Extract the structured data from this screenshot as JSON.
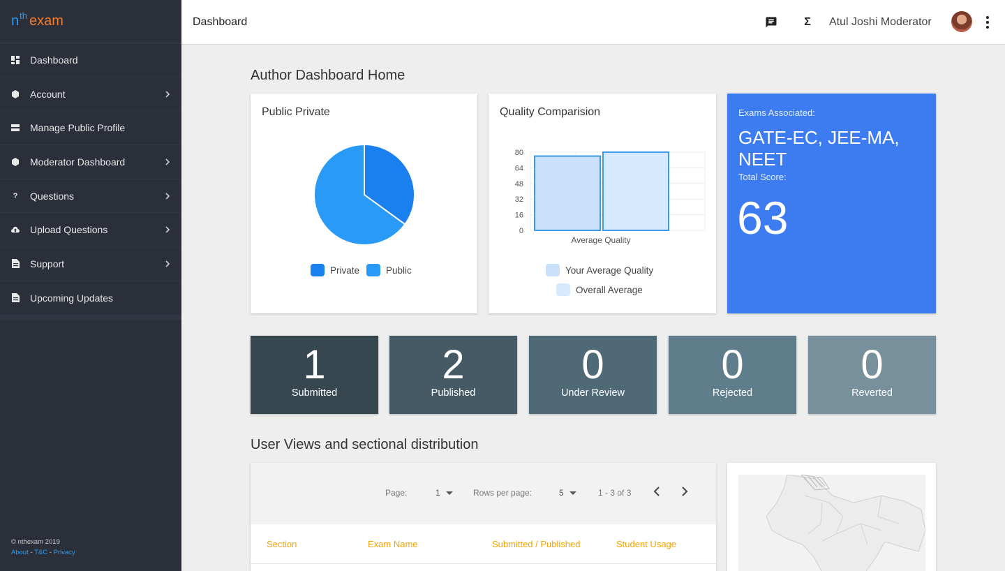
{
  "brand": {
    "n": "n",
    "th": "th",
    "exam": "exam"
  },
  "sidebar": {
    "items": [
      {
        "label": "Dashboard",
        "icon": "dashboard-icon",
        "chevron": false
      },
      {
        "label": "Account",
        "icon": "account-icon",
        "chevron": true
      },
      {
        "label": "Manage Public Profile",
        "icon": "profile-card-icon",
        "chevron": false
      },
      {
        "label": "Moderator Dashboard",
        "icon": "moderator-icon",
        "chevron": true
      },
      {
        "label": "Questions",
        "icon": "question-icon",
        "chevron": true
      },
      {
        "label": "Upload Questions",
        "icon": "cloud-upload-icon",
        "chevron": true
      },
      {
        "label": "Support",
        "icon": "document-icon",
        "chevron": true
      },
      {
        "label": "Upcoming Updates",
        "icon": "document-icon",
        "chevron": false
      }
    ],
    "footer": {
      "copyright": "© nthexam 2019",
      "about": "About",
      "tc": "T&C",
      "privacy": "Privacy",
      "sep": "-"
    }
  },
  "topbar": {
    "title": "Dashboard",
    "user": "Atul Joshi Moderator",
    "icons": [
      "feedback-icon",
      "sigma-icon",
      "avatar",
      "more-vert-icon"
    ]
  },
  "main": {
    "section1_title": "Author Dashboard Home",
    "section2_title": "User Views and sectional distribution"
  },
  "public_private": {
    "title": "Public Private",
    "legend": [
      "Private",
      "Public"
    ]
  },
  "quality": {
    "title": "Quality Comparision",
    "legend": [
      "Your Average Quality",
      "Overall Average"
    ]
  },
  "exams": {
    "assoc_label": "Exams Associated:",
    "assoc_value": "GATE-EC, JEE-MA, NEET",
    "score_label": "Total Score:",
    "score_value": "63"
  },
  "stats": [
    {
      "num": "1",
      "label": "Submitted",
      "color": "#37474f"
    },
    {
      "num": "2",
      "label": "Published",
      "color": "#455a64"
    },
    {
      "num": "0",
      "label": "Under Review",
      "color": "#4f6a76"
    },
    {
      "num": "0",
      "label": "Rejected",
      "color": "#5f7d8a"
    },
    {
      "num": "0",
      "label": "Reverted",
      "color": "#78909c"
    }
  ],
  "table": {
    "page_label": "Page:",
    "page_value": "1",
    "rows_label": "Rows per page:",
    "rows_value": "5",
    "range": "1 - 3 of 3",
    "columns": [
      "Section",
      "Exam Name",
      "Submitted / Published",
      "Student Usage"
    ]
  },
  "chart_data": [
    {
      "type": "pie",
      "title": "Public Private",
      "categories": [
        "Private",
        "Public"
      ],
      "values": [
        35,
        65
      ],
      "colors": [
        "#1a7fef",
        "#2a9af7"
      ]
    },
    {
      "type": "bar",
      "title": "Quality Comparision",
      "categories": [
        "Average Quality"
      ],
      "series": [
        {
          "name": "Your Average Quality",
          "values": [
            76
          ]
        },
        {
          "name": "Overall Average",
          "values": [
            80
          ]
        }
      ],
      "ylim": [
        0,
        80
      ],
      "yticks": [
        "80",
        "64",
        "48",
        "32",
        "16",
        "0"
      ],
      "colors": [
        "#c9e1fb",
        "#d6e9fd"
      ],
      "border": "#3c9ae8"
    }
  ]
}
